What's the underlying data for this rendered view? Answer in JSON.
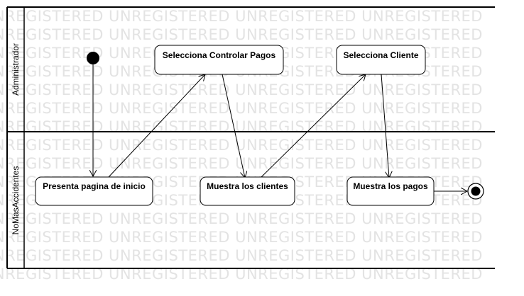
{
  "diagram": {
    "type": "uml-activity-diagram",
    "watermark_text": "UNREGISTERED UNREGISTERED UNREGISTERED UNREGISTERED",
    "swimlanes": [
      {
        "id": "admin",
        "label": "Administrador"
      },
      {
        "id": "system",
        "label": "NoMasAccidentes"
      }
    ],
    "nodes": [
      {
        "id": "start",
        "kind": "initial",
        "lane": "admin"
      },
      {
        "id": "select-payments",
        "kind": "action",
        "lane": "admin",
        "label": "Selecciona Controlar Pagos"
      },
      {
        "id": "select-client",
        "kind": "action",
        "lane": "admin",
        "label": "Selecciona Cliente"
      },
      {
        "id": "home-page",
        "kind": "action",
        "lane": "system",
        "label": "Presenta pagina de inicio"
      },
      {
        "id": "show-clients",
        "kind": "action",
        "lane": "system",
        "label": "Muestra los clientes"
      },
      {
        "id": "show-payments",
        "kind": "action",
        "lane": "system",
        "label": "Muestra los pagos"
      },
      {
        "id": "end",
        "kind": "final",
        "lane": "system"
      }
    ],
    "edges": [
      {
        "from": "start",
        "to": "home-page"
      },
      {
        "from": "home-page",
        "to": "select-payments"
      },
      {
        "from": "select-payments",
        "to": "show-clients"
      },
      {
        "from": "show-clients",
        "to": "select-client"
      },
      {
        "from": "select-client",
        "to": "show-payments"
      },
      {
        "from": "show-payments",
        "to": "end"
      }
    ]
  }
}
